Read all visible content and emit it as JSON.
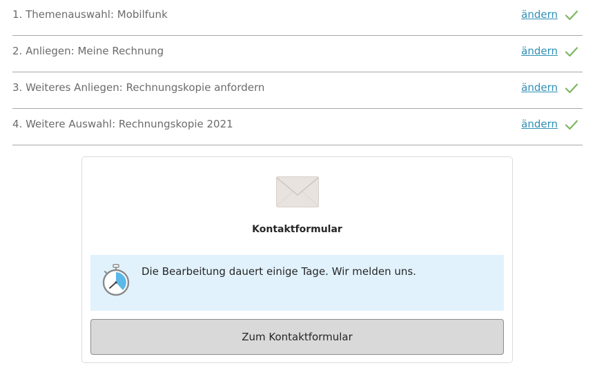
{
  "steps": [
    {
      "label": "1. Themenauswahl: Mobilfunk",
      "change": "ändern",
      "icon": "check-icon"
    },
    {
      "label": "2. Anliegen: Meine Rechnung",
      "change": "ändern",
      "icon": "check-icon"
    },
    {
      "label": "3. Weiteres Anliegen: Rechnungskopie anfordern",
      "change": "ändern",
      "icon": "check-icon"
    },
    {
      "label": "4. Weitere Auswahl: Rechnungskopie 2021",
      "change": "ändern",
      "icon": "check-icon"
    }
  ],
  "card": {
    "icon": "envelope-icon",
    "title": "Kontaktformular",
    "info": {
      "icon": "stopwatch-icon",
      "text": "Die Bearbeitung dauert einige Tage. Wir melden uns."
    },
    "button_label": "Zum Kontaktformular"
  },
  "colors": {
    "link": "#2f8fb5",
    "check": "#7bb661",
    "info_background": "#e1f2fc",
    "button_background": "#d9d9d9",
    "divider": "#a6a6a6"
  }
}
